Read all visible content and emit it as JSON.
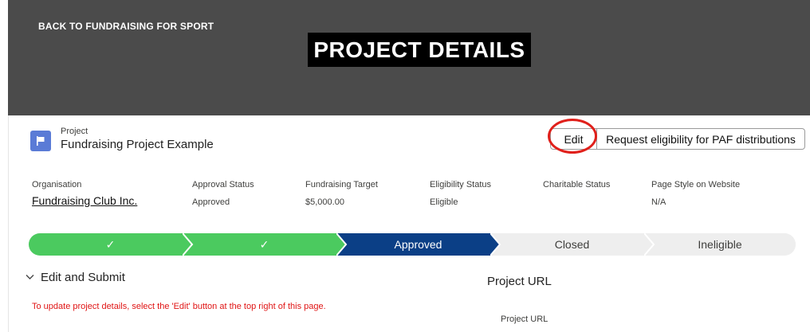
{
  "hero": {
    "back_link": "BACK TO FUNDRAISING FOR SPORT",
    "title": "PROJECT DETAILS",
    "background_color": "#4b4b4b"
  },
  "record": {
    "object_type": "Project",
    "name": "Fundraising Project Example",
    "icon": "flag-icon",
    "icon_color": "#5a7bd6"
  },
  "actions": {
    "edit_label": "Edit",
    "paf_label": "Request eligibility for PAF distributions",
    "highlight_color": "#e0201b"
  },
  "fields": [
    {
      "label": "Organisation",
      "value": "Fundraising Club Inc."
    },
    {
      "label": "Approval Status",
      "value": "Approved"
    },
    {
      "label": "Fundraising Target",
      "value": "$5,000.00"
    },
    {
      "label": "Eligibility Status",
      "value": "Eligible"
    },
    {
      "label": "Charitable Status",
      "value": ""
    },
    {
      "label": "Page Style on Website",
      "value": "N/A"
    }
  ],
  "path": {
    "stages": [
      {
        "label": "✓",
        "state": "complete"
      },
      {
        "label": "✓",
        "state": "complete"
      },
      {
        "label": "Approved",
        "state": "current"
      },
      {
        "label": "Closed",
        "state": "incomplete"
      },
      {
        "label": "Ineligible",
        "state": "incomplete"
      }
    ],
    "complete_color": "#4bca5f",
    "current_color": "#0b3f86",
    "incomplete_color": "#eeeeee"
  },
  "section": {
    "title": "Edit and Submit",
    "help_text": "To update project details, select the 'Edit' button at the top right of this page."
  },
  "project_url": {
    "title": "Project URL",
    "label": "Project URL"
  }
}
